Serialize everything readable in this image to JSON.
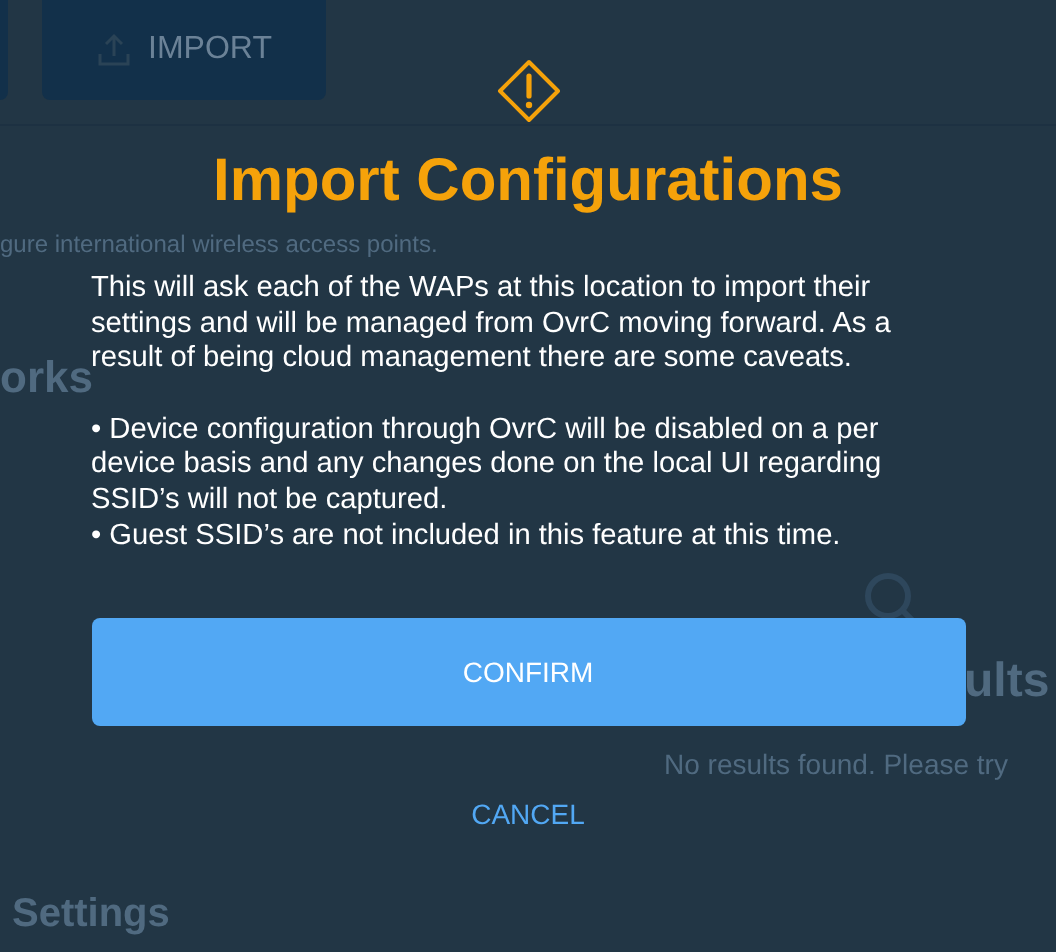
{
  "background_page": {
    "import_button": "IMPORT",
    "description": "gure international wireless access points.",
    "section_heading": "orks",
    "results_heading": "ults",
    "results_message": "No results found. Please try",
    "settings_heading": "Settings"
  },
  "dialog": {
    "title": "Import Configurations",
    "body": "This will ask each of the WAPs at this location to import their settings and will be managed from OvrC moving forward. As a result of being cloud management there are some caveats.",
    "bullets": [
      "• Device configuration through OvrC will be disabled on a per device basis and any changes done on the local UI regarding SSID’s will not be captured.",
      "• Guest SSID’s are not included in this feature at this time."
    ],
    "buttons": [
      {
        "label": "CONFIRM",
        "kind": "primary"
      },
      {
        "label": "CANCEL",
        "kind": "link"
      }
    ]
  }
}
